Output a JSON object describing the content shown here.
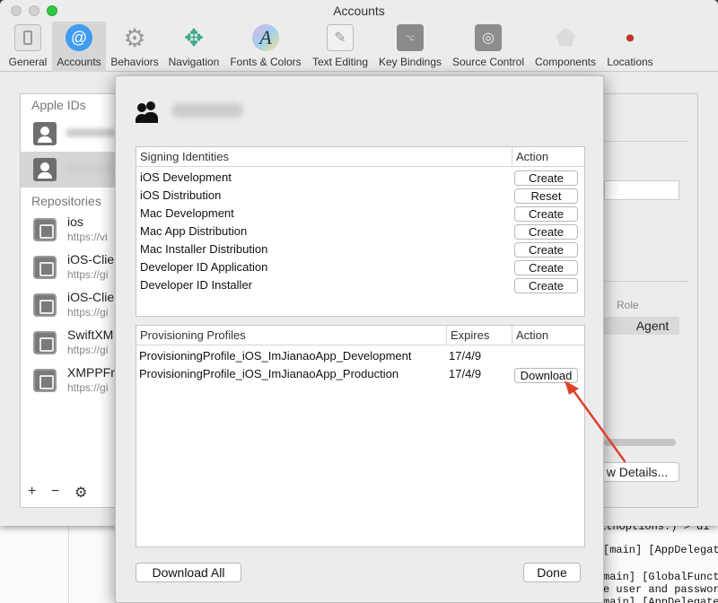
{
  "window": {
    "title": "Accounts"
  },
  "toolbar": {
    "items": [
      {
        "label": "General",
        "icon": "general-icon"
      },
      {
        "label": "Accounts",
        "icon": "at-sign-icon"
      },
      {
        "label": "Behaviors",
        "icon": "gear-icon"
      },
      {
        "label": "Navigation",
        "icon": "navigation-arrows-icon"
      },
      {
        "label": "Fonts & Colors",
        "icon": "font-color-icon"
      },
      {
        "label": "Text Editing",
        "icon": "text-editing-icon"
      },
      {
        "label": "Key Bindings",
        "icon": "keyboard-icon"
      },
      {
        "label": "Source Control",
        "icon": "vault-icon"
      },
      {
        "label": "Components",
        "icon": "shield-icon"
      },
      {
        "label": "Locations",
        "icon": "joystick-icon"
      }
    ],
    "selected": "Accounts"
  },
  "left_panel": {
    "apple_ids_header": "Apple IDs",
    "repositories_header": "Repositories",
    "repositories": [
      {
        "name": "ios",
        "url": "https://vi"
      },
      {
        "name": "iOS-Clie",
        "url": "https://gi"
      },
      {
        "name": "iOS-Clie",
        "url": "https://gi"
      },
      {
        "name": "SwiftXM",
        "url": "https://gi"
      },
      {
        "name": "XMPPFra",
        "url": "https://gi"
      }
    ],
    "footer": {
      "add": "+",
      "remove": "−",
      "settings": "⚙"
    }
  },
  "right_panel": {
    "role_header": "Role",
    "role_value": "Agent",
    "details_button": "w Details..."
  },
  "sheet": {
    "signing": {
      "headers": {
        "name": "Signing Identities",
        "action": "Action"
      },
      "rows": [
        {
          "name": "iOS Development",
          "action": "Create"
        },
        {
          "name": "iOS Distribution",
          "action": "Reset"
        },
        {
          "name": "Mac Development",
          "action": "Create"
        },
        {
          "name": "Mac App Distribution",
          "action": "Create"
        },
        {
          "name": "Mac Installer Distribution",
          "action": "Create"
        },
        {
          "name": "Developer ID Application",
          "action": "Create"
        },
        {
          "name": "Developer ID Installer",
          "action": "Create"
        }
      ]
    },
    "profiles": {
      "headers": {
        "name": "Provisioning Profiles",
        "expires": "Expires",
        "action": "Action"
      },
      "rows": [
        {
          "name": "ProvisioningProfile_iOS_ImJianaoApp_Development",
          "expires": "17/4/9",
          "action": ""
        },
        {
          "name": "ProvisioningProfile_iOS_ImJianaoApp_Production",
          "expires": "17/4/9",
          "action": "Download"
        }
      ]
    },
    "download_all_button": "Download All",
    "done_button": "Done"
  },
  "code_editor": {
    "lines": [
      "ithOptions:) > di",
      "[main] [AppDelegate",
      "main] [GlobalFuncti",
      "e user and passwor",
      "main] [AppDelegate"
    ]
  },
  "colors": {
    "accent": "#3f9cf0",
    "annotation_arrow": "#e0402e"
  }
}
